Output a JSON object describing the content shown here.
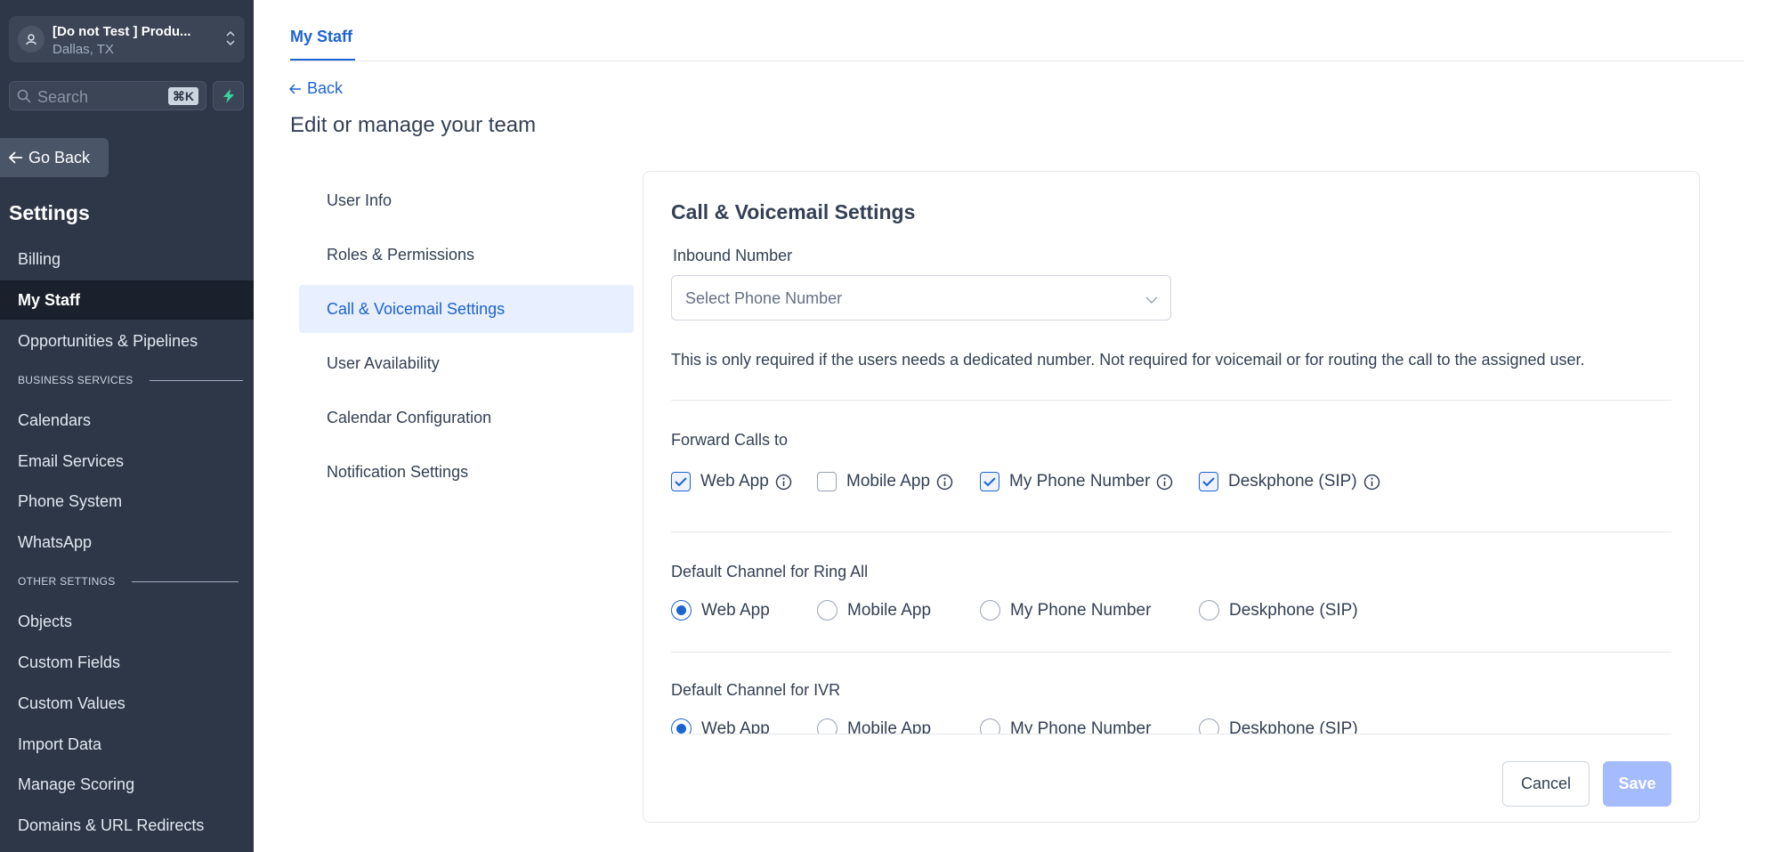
{
  "location": {
    "name": "[Do not Test ] Produ...",
    "city": "Dallas, TX"
  },
  "search": {
    "placeholder": "Search",
    "shortcut": "⌘K"
  },
  "sidebar": {
    "go_back": "Go Back",
    "title": "Settings",
    "items": [
      {
        "label": "Billing"
      },
      {
        "label": "My Staff",
        "active": true
      },
      {
        "label": "Opportunities & Pipelines"
      }
    ],
    "business_section": "BUSINESS SERVICES",
    "business_items": [
      {
        "label": "Calendars"
      },
      {
        "label": "Email Services"
      },
      {
        "label": "Phone System"
      },
      {
        "label": "WhatsApp"
      }
    ],
    "other_section": "OTHER SETTINGS",
    "other_items": [
      {
        "label": "Objects"
      },
      {
        "label": "Custom Fields"
      },
      {
        "label": "Custom Values"
      },
      {
        "label": "Import Data"
      },
      {
        "label": "Manage Scoring"
      },
      {
        "label": "Domains & URL Redirects"
      }
    ]
  },
  "header": {
    "tab": "My Staff",
    "back": "Back",
    "title": "Edit or manage your team"
  },
  "subnav": [
    {
      "label": "User Info"
    },
    {
      "label": "Roles & Permissions"
    },
    {
      "label": "Call & Voicemail Settings",
      "active": true
    },
    {
      "label": "User Availability"
    },
    {
      "label": "Calendar Configuration"
    },
    {
      "label": "Notification Settings"
    }
  ],
  "card": {
    "title": "Call & Voicemail Settings",
    "inbound_label": "Inbound Number",
    "select_placeholder": "Select Phone Number",
    "helper": "This is only required if the users needs a dedicated number. Not required for voicemail or for routing the call to the assigned user.",
    "forward_label": "Forward Calls to",
    "forward_options": [
      {
        "label": "Web App",
        "checked": true
      },
      {
        "label": "Mobile App",
        "checked": false
      },
      {
        "label": "My Phone Number",
        "checked": true
      },
      {
        "label": "Deskphone (SIP)",
        "checked": true
      }
    ],
    "ring_all_label": "Default Channel for Ring All",
    "ring_all_options": [
      {
        "label": "Web App",
        "selected": true
      },
      {
        "label": "Mobile App",
        "selected": false
      },
      {
        "label": "My Phone Number",
        "selected": false
      },
      {
        "label": "Deskphone (SIP)",
        "selected": false
      }
    ],
    "ivr_label": "Default Channel for IVR",
    "ivr_options": [
      {
        "label": "Web App",
        "selected": true
      },
      {
        "label": "Mobile App",
        "selected": false
      },
      {
        "label": "My Phone Number",
        "selected": false
      },
      {
        "label": "Deskphone (SIP)",
        "selected": false
      }
    ],
    "cancel": "Cancel",
    "save": "Save"
  },
  "colors": {
    "accent": "#1d63d1",
    "sidebar_bg": "#2d3748",
    "active_nav_bg": "#1a202c",
    "save_disabled": "#a4bcfd"
  }
}
